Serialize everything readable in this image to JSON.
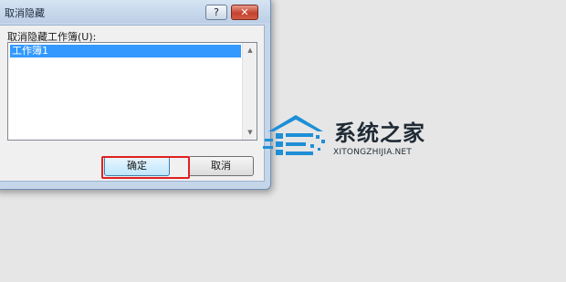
{
  "dialog": {
    "title": "取消隐藏",
    "help_label": "?",
    "close_label": "✕",
    "list_label": "取消隐藏工作簿(U):",
    "items": [
      {
        "label": "工作簿1",
        "selected": true
      }
    ],
    "ok_label": "确定",
    "cancel_label": "取消"
  },
  "watermark": {
    "title": "系统之家",
    "url": "XITONGZHIJIA.NET"
  },
  "colors": {
    "selection": "#3399ff",
    "highlight_box": "#e02020",
    "watermark_blue": "#1e8fd6"
  }
}
